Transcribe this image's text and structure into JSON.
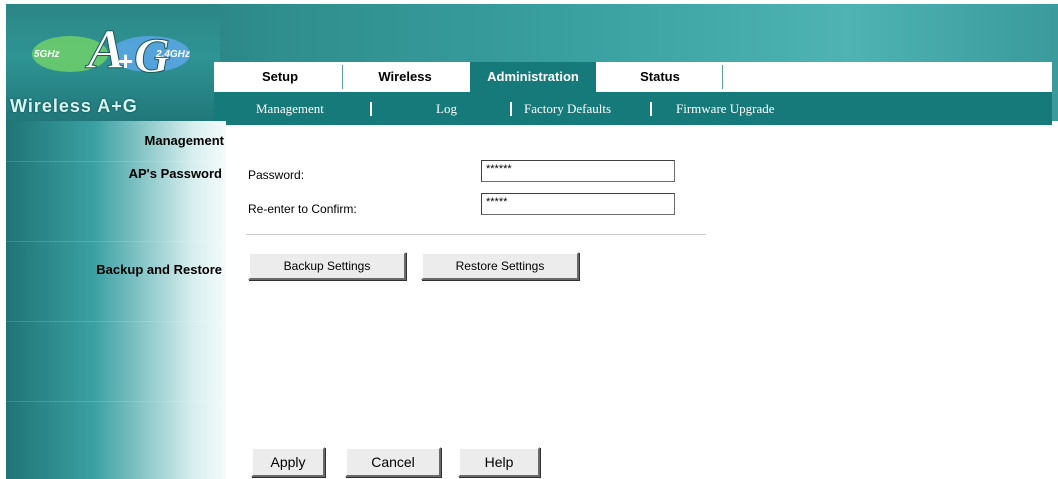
{
  "logo": {
    "badge_left": "5GHz",
    "badge_right": "2.4GHz",
    "brand": "Wireless A+G"
  },
  "tabs": [
    {
      "label": "Setup",
      "active": false
    },
    {
      "label": "Wireless",
      "active": false
    },
    {
      "label": "Administration",
      "active": true
    },
    {
      "label": "Status",
      "active": false
    }
  ],
  "subtabs": [
    {
      "label": "Management"
    },
    {
      "label": "Log"
    },
    {
      "label": "Factory Defaults"
    },
    {
      "label": "Firmware Upgrade"
    }
  ],
  "sidebar": {
    "section_title": "Management",
    "password_section": "AP's Password",
    "backup_section": "Backup and Restore"
  },
  "password": {
    "password_label": "Password:",
    "password_value": "******",
    "confirm_label": "Re-enter to Confirm:",
    "confirm_value": "*****"
  },
  "backup": {
    "backup_label": "Backup Settings",
    "restore_label": "Restore Settings"
  },
  "footer": {
    "apply_label": "Apply",
    "cancel_label": "Cancel",
    "help_label": "Help"
  },
  "colors": {
    "accent": "#177a7a",
    "sidebar_dark": "#1f7476"
  }
}
